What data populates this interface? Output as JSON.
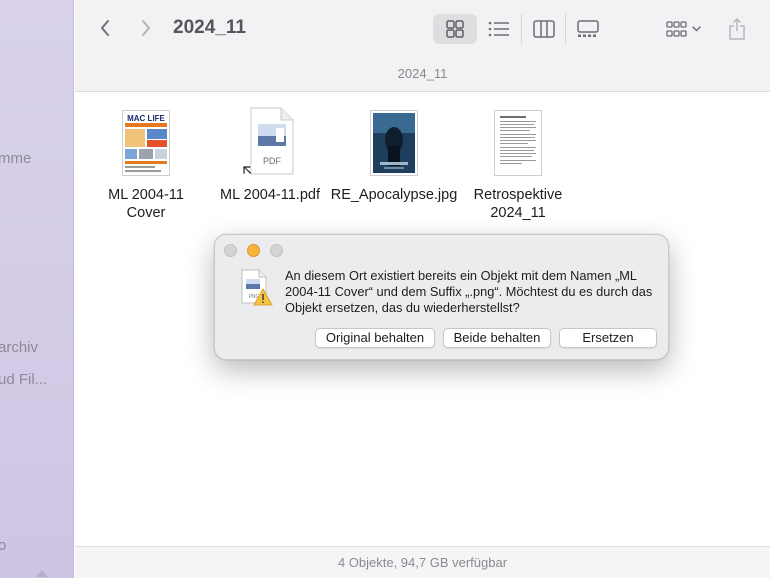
{
  "sidebar": {
    "items": [
      "mme",
      "archiv",
      "ud Fil...",
      "o"
    ]
  },
  "toolbar": {
    "title": "2024_11",
    "path_label": "2024_11",
    "back_icon": "chevron-left-icon",
    "forward_icon": "chevron-right-icon",
    "views": [
      "icon-view-icon",
      "list-view-icon",
      "column-view-icon",
      "gallery-view-icon"
    ],
    "group_icon": "group-by-icon",
    "share_icon": "share-icon"
  },
  "files": [
    {
      "name": "ML 2004-11\nCover",
      "kind": "magazine-cover",
      "thumb_brand": "MAC LIFE"
    },
    {
      "name": "ML 2004-11.pdf",
      "kind": "pdf-alias",
      "thumb_label": "PDF"
    },
    {
      "name": "RE_Apocalypse.jpg",
      "kind": "movie-poster"
    },
    {
      "name": "Retrospektive\n2024_11",
      "kind": "text-document"
    }
  ],
  "status": {
    "text": "4 Objekte, 94,7 GB verfügbar"
  },
  "dialog": {
    "message": "An diesem Ort existiert bereits ein Objekt mit dem Namen „ML 2004-11 Cover“ und dem Suffix „.png“. Möchtest du es durch das Objekt ersetzen, das du wiederherstellst?",
    "buttons": {
      "keep_original": "Original behalten",
      "keep_both": "Beide behalten",
      "replace": "Ersetzen"
    },
    "icon": "png-warning-icon"
  },
  "colors": {
    "sidebar": "#d6cfe8",
    "toolbar": "#f2f1f3",
    "traffic_minimize": "#f5b43a",
    "traffic_inactive": "#d4d4d6"
  }
}
